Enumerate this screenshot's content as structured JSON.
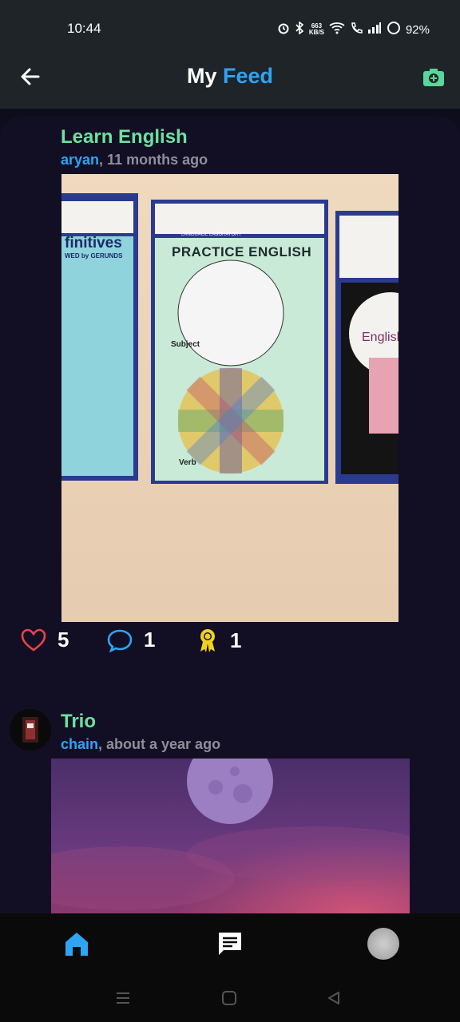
{
  "status": {
    "time": "10:44",
    "speed_value": "663",
    "speed_unit": "KB/S",
    "battery": "92%"
  },
  "header": {
    "title_part1": "My",
    "title_part2": "Feed"
  },
  "posts": [
    {
      "title": "Learn English",
      "user": "aryan",
      "time": ", 11 months ago",
      "likes": "5",
      "comments": "1",
      "awards": "1",
      "image": {
        "chart_title": "PRACTICE ENGLISH",
        "subject_label": "Subject",
        "verb_label": "Verb",
        "poster_heading": "finitives",
        "poster_sub": "WED by GERUNDS",
        "lab_label": "LANGUAGE LABORATORY",
        "right_poster_text": "English"
      }
    },
    {
      "title": "Trio",
      "user": "chain",
      "time": ", about a year ago"
    }
  ],
  "colors": {
    "accent": "#2ea4f3",
    "title_green": "#6fe0a0",
    "heart": "#e8434a",
    "award": "#f1d21b"
  },
  "icons": [
    "back-arrow-icon",
    "camera-icon",
    "heart-icon",
    "comment-icon",
    "award-icon",
    "home-icon",
    "chat-icon",
    "avatar"
  ]
}
